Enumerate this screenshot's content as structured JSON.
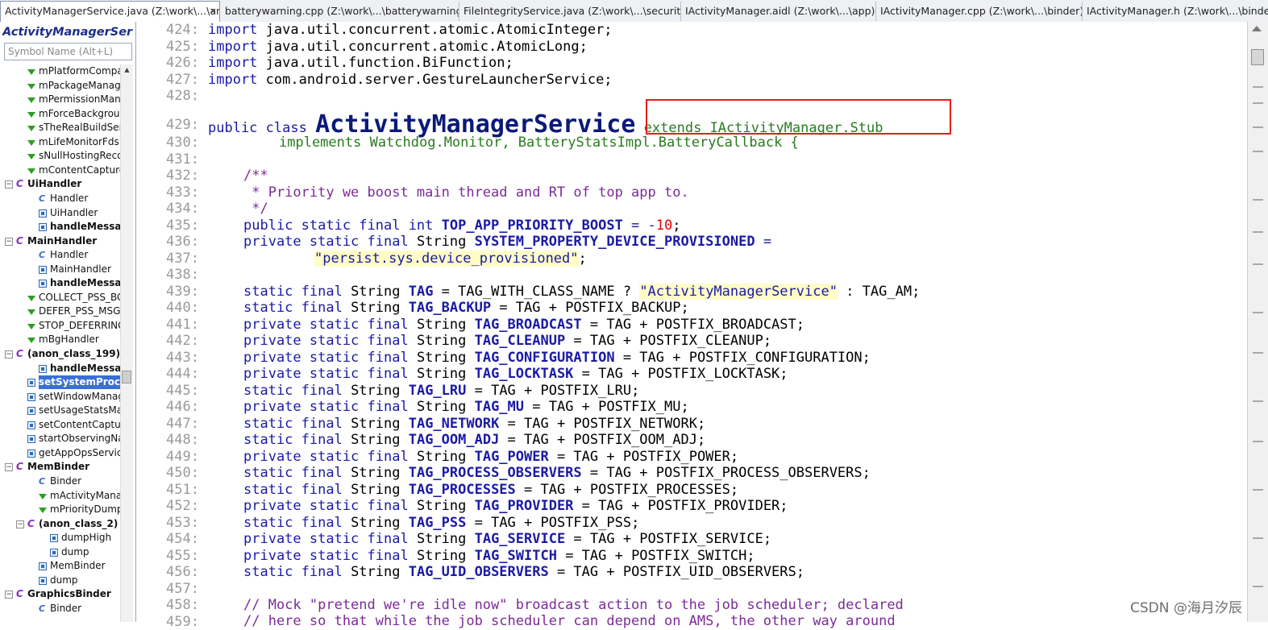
{
  "tabs": [
    {
      "label": "ActivityManagerService.java (Z:\\work\\...\\am)",
      "close": "×"
    },
    {
      "label": "batterywarning.cpp (Z:\\work\\...\\batterywarning)"
    },
    {
      "label": "FileIntegrityService.java (Z:\\work\\...\\security)"
    },
    {
      "label": "IActivityManager.aidl (Z:\\work\\...\\app)"
    },
    {
      "label": "IActivityManager.cpp (Z:\\work\\...\\binder)"
    },
    {
      "label": "IActivityManager.h (Z:\\work\\...\\binder)"
    }
  ],
  "sidebar": {
    "title": "ActivityManagerService",
    "search_placeholder": "Symbol Name (Alt+L)",
    "items": [
      {
        "label": "mPlatformCompat",
        "icon": "field-icon"
      },
      {
        "label": "mPackageManagerInt",
        "icon": "field-icon"
      },
      {
        "label": "mPermissionManagerInt",
        "icon": "field-icon"
      },
      {
        "label": "mForceBackgroundCheck",
        "icon": "field-icon"
      },
      {
        "label": "sTheRealBuildSerial",
        "icon": "field-icon"
      },
      {
        "label": "mLifeMonitorFds",
        "icon": "field-icon"
      },
      {
        "label": "sNullHostingRecord",
        "icon": "field-icon"
      },
      {
        "label": "mContentCaptureService",
        "icon": "field-icon"
      },
      {
        "label": "UiHandler",
        "icon": "class-icon"
      },
      {
        "label": "Handler",
        "icon": "constructor-icon"
      },
      {
        "label": "UiHandler",
        "icon": "method-icon"
      },
      {
        "label": "handleMessage",
        "icon": "method-icon"
      },
      {
        "label": "MainHandler",
        "icon": "class-icon"
      },
      {
        "label": "Handler",
        "icon": "constructor-icon"
      },
      {
        "label": "MainHandler",
        "icon": "method-icon"
      },
      {
        "label": "handleMessage",
        "icon": "method-icon"
      },
      {
        "label": "COLLECT_PSS_BG_MSG",
        "icon": "field-icon"
      },
      {
        "label": "DEFER_PSS_MSG",
        "icon": "field-icon"
      },
      {
        "label": "STOP_DEFERRING_PSS_MSG",
        "icon": "field-icon"
      },
      {
        "label": "mBgHandler",
        "icon": "field-icon"
      },
      {
        "label": "(anon_class_199)",
        "icon": "class-icon"
      },
      {
        "label": "handleMessage",
        "icon": "method-icon"
      },
      {
        "label": "setSystemProcess",
        "icon": "method-icon"
      },
      {
        "label": "setWindowManager",
        "icon": "method-icon"
      },
      {
        "label": "setUsageStatsManager",
        "icon": "method-icon"
      },
      {
        "label": "setContentCaptureManager",
        "icon": "method-icon"
      },
      {
        "label": "startObservingNativeCrashes",
        "icon": "method-icon"
      },
      {
        "label": "getAppOpsService",
        "icon": "method-icon"
      },
      {
        "label": "MemBinder",
        "icon": "class-icon"
      },
      {
        "label": "Binder",
        "icon": "constructor-icon"
      },
      {
        "label": "mActivityManagerService",
        "icon": "field-icon"
      },
      {
        "label": "mPriorityDumper",
        "icon": "field-icon"
      },
      {
        "label": "(anon_class_2)",
        "icon": "class-icon"
      },
      {
        "label": "dumpHigh",
        "icon": "method-icon"
      },
      {
        "label": "dump",
        "icon": "method-icon"
      },
      {
        "label": "MemBinder",
        "icon": "method-icon"
      },
      {
        "label": "dump",
        "icon": "method-icon"
      },
      {
        "label": "GraphicsBinder",
        "icon": "class-icon"
      },
      {
        "label": "Binder",
        "icon": "constructor-icon"
      }
    ]
  },
  "editor": {
    "line_numbers": [
      "424:",
      "425:",
      "426:",
      "427:",
      "428:",
      "429:",
      "430:",
      "431:",
      "432:",
      "433:",
      "434:",
      "435:",
      "436:",
      "437:",
      "438:",
      "439:",
      "440:",
      "441:",
      "442:",
      "443:",
      "444:",
      "445:",
      "446:",
      "447:",
      "448:",
      "449:",
      "450:",
      "451:",
      "452:",
      "453:",
      "454:",
      "455:",
      "456:",
      "457:",
      "458:",
      "459:"
    ],
    "tokens": {
      "import": "import",
      "l424": "java.util.concurrent.atomic.AtomicInteger;",
      "l425": "java.util.concurrent.atomic.AtomicLong;",
      "l426": "java.util.function.BiFunction;",
      "l427": "com.android.server.GestureLauncherService;",
      "public_class": "public class",
      "class_name": "ActivityManagerService",
      "extends": "extends IActivityManager.Stub",
      "implements": "implements Watchdog.Monitor, BatteryStatsImpl.BatteryCallback {",
      "c432": "/**",
      "c433": " * Priority we boost main thread and RT of top app to.",
      "c434": " */",
      "l435_a": "public static final int ",
      "l435_b": "TOP_APP_PRIORITY_BOOST",
      "l435_c": " = -",
      "l435_d": "10",
      "l435_e": ";",
      "l436_a": "private static final ",
      "l436_t": "String ",
      "l436_b": "SYSTEM_PROPERTY_DEVICE_PROVISIONED",
      "l436_c": " =",
      "l437": "\"persist.sys.device_provisioned\"",
      "semi": ";",
      "l439_a": "static final ",
      "l439_t": "String ",
      "l439_b": "TAG",
      "l439_c": " = TAG_WITH_CLASS_NAME ? ",
      "l439_s": "\"ActivityManagerService\"",
      "l439_d": " : TAG_AM;",
      "c458": "// Mock \"pretend we're idle now\" broadcast action to the job scheduler; declared",
      "c459": "// here so that while the job scheduler can depend on AMS, the other way around"
    },
    "tag_lines": [
      {
        "mods": "static final ",
        "type": "String ",
        "name": "TAG_BACKUP",
        "rest": " = TAG + POSTFIX_BACKUP;"
      },
      {
        "mods": "private static final ",
        "type": "String ",
        "name": "TAG_BROADCAST",
        "rest": " = TAG + POSTFIX_BROADCAST;"
      },
      {
        "mods": "private static final ",
        "type": "String ",
        "name": "TAG_CLEANUP",
        "rest": " = TAG + POSTFIX_CLEANUP;"
      },
      {
        "mods": "private static final ",
        "type": "String ",
        "name": "TAG_CONFIGURATION",
        "rest": " = TAG + POSTFIX_CONFIGURATION;"
      },
      {
        "mods": "private static final ",
        "type": "String ",
        "name": "TAG_LOCKTASK",
        "rest": " = TAG + POSTFIX_LOCKTASK;"
      },
      {
        "mods": "static final ",
        "type": "String ",
        "name": "TAG_LRU",
        "rest": " = TAG + POSTFIX_LRU;"
      },
      {
        "mods": "private static final ",
        "type": "String ",
        "name": "TAG_MU",
        "rest": " = TAG + POSTFIX_MU;"
      },
      {
        "mods": "static final ",
        "type": "String ",
        "name": "TAG_NETWORK",
        "rest": " = TAG + POSTFIX_NETWORK;"
      },
      {
        "mods": "static final ",
        "type": "String ",
        "name": "TAG_OOM_ADJ",
        "rest": " = TAG + POSTFIX_OOM_ADJ;"
      },
      {
        "mods": "private static final ",
        "type": "String ",
        "name": "TAG_POWER",
        "rest": " = TAG + POSTFIX_POWER;"
      },
      {
        "mods": "static final ",
        "type": "String ",
        "name": "TAG_PROCESS_OBSERVERS",
        "rest": " = TAG + POSTFIX_PROCESS_OBSERVERS;"
      },
      {
        "mods": "static final ",
        "type": "String ",
        "name": "TAG_PROCESSES",
        "rest": " = TAG + POSTFIX_PROCESSES;"
      },
      {
        "mods": "private static final ",
        "type": "String ",
        "name": "TAG_PROVIDER",
        "rest": " = TAG + POSTFIX_PROVIDER;"
      },
      {
        "mods": "static final ",
        "type": "String ",
        "name": "TAG_PSS",
        "rest": " = TAG + POSTFIX_PSS;"
      },
      {
        "mods": "private static final ",
        "type": "String ",
        "name": "TAG_SERVICE",
        "rest": " = TAG + POSTFIX_SERVICE;"
      },
      {
        "mods": "private static final ",
        "type": "String ",
        "name": "TAG_SWITCH",
        "rest": " = TAG + POSTFIX_SWITCH;"
      },
      {
        "mods": "static final ",
        "type": "String ",
        "name": "TAG_UID_OBSERVERS",
        "rest": " = TAG + POSTFIX_UID_OBSERVERS;"
      }
    ]
  },
  "watermark": "CSDN @海月汐辰",
  "colors": {
    "keyword": "#1a1aa6",
    "comment": "#7b2b98",
    "annotation_box": "#e02020",
    "selection": "#3a6fd8"
  }
}
